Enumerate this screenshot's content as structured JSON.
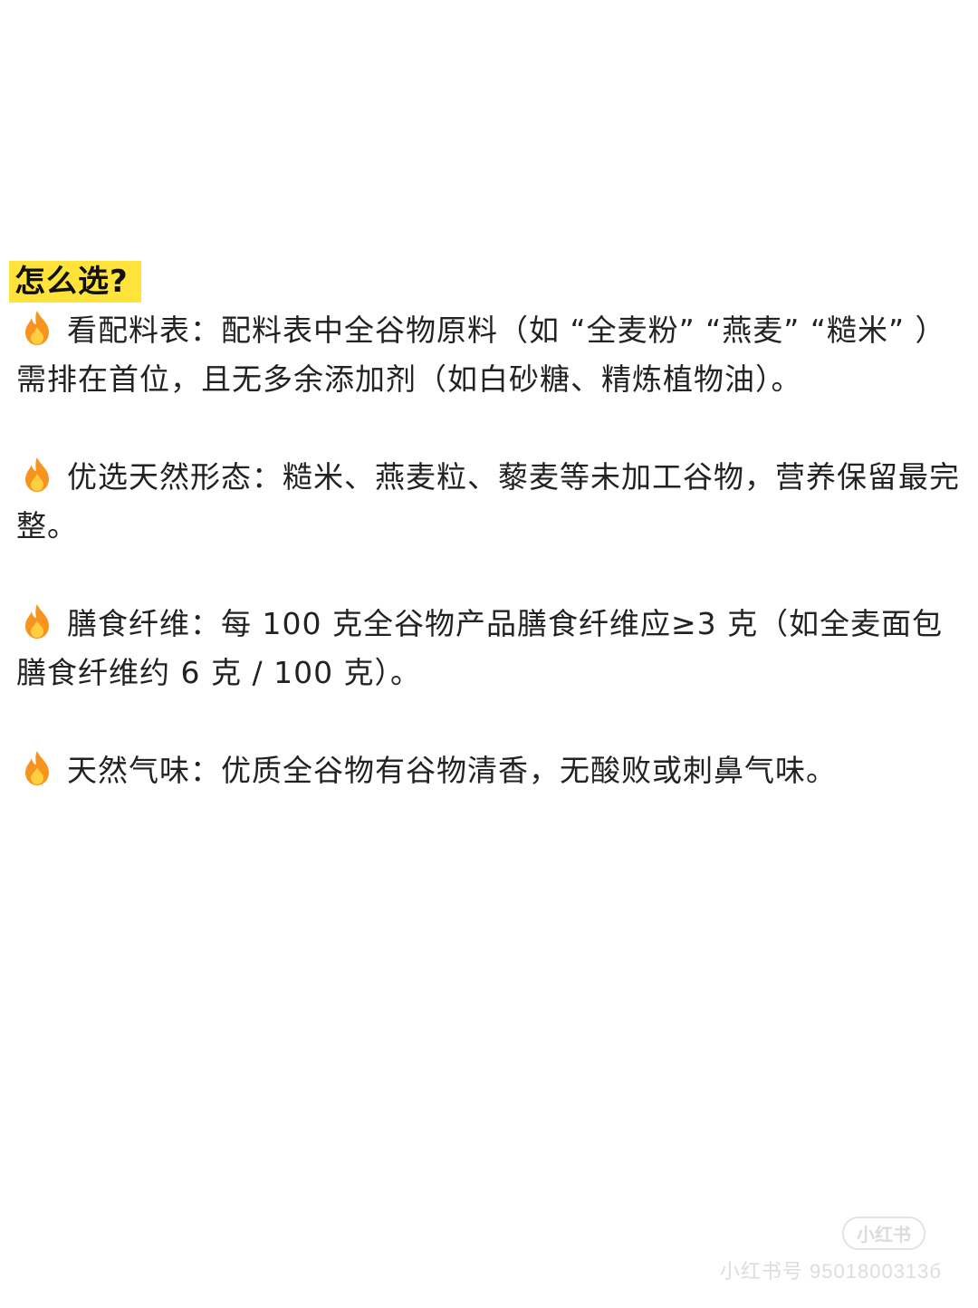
{
  "heading": "怎么选?",
  "items": [
    {
      "icon": "fire-icon",
      "text": "看配料表：配料表中全谷物原料（如 “全麦粉” “燕麦” “糙米” ）需排在首位，且无多余添加剂（如白砂糖、精炼植物油）。"
    },
    {
      "icon": "fire-icon",
      "text": "优选天然形态：糙米、燕麦粒、藜麦等未加工谷物，营养保留最完整。"
    },
    {
      "icon": "fire-icon",
      "text": "膳食纤维：每 100 克全谷物产品膳食纤维应≥3 克（如全麦面包膳食纤维约 6 克 / 100 克）。"
    },
    {
      "icon": "fire-icon",
      "text": "天然气味：优质全谷物有谷物清香，无酸败或刺鼻气味。"
    }
  ],
  "watermark": {
    "logo": "小红书",
    "id_text": "小红书号 9501800313б"
  },
  "colors": {
    "highlight": "#ffe33a",
    "flame_outer": "#f7931e",
    "flame_inner": "#ffcf3f",
    "text": "#222222"
  }
}
